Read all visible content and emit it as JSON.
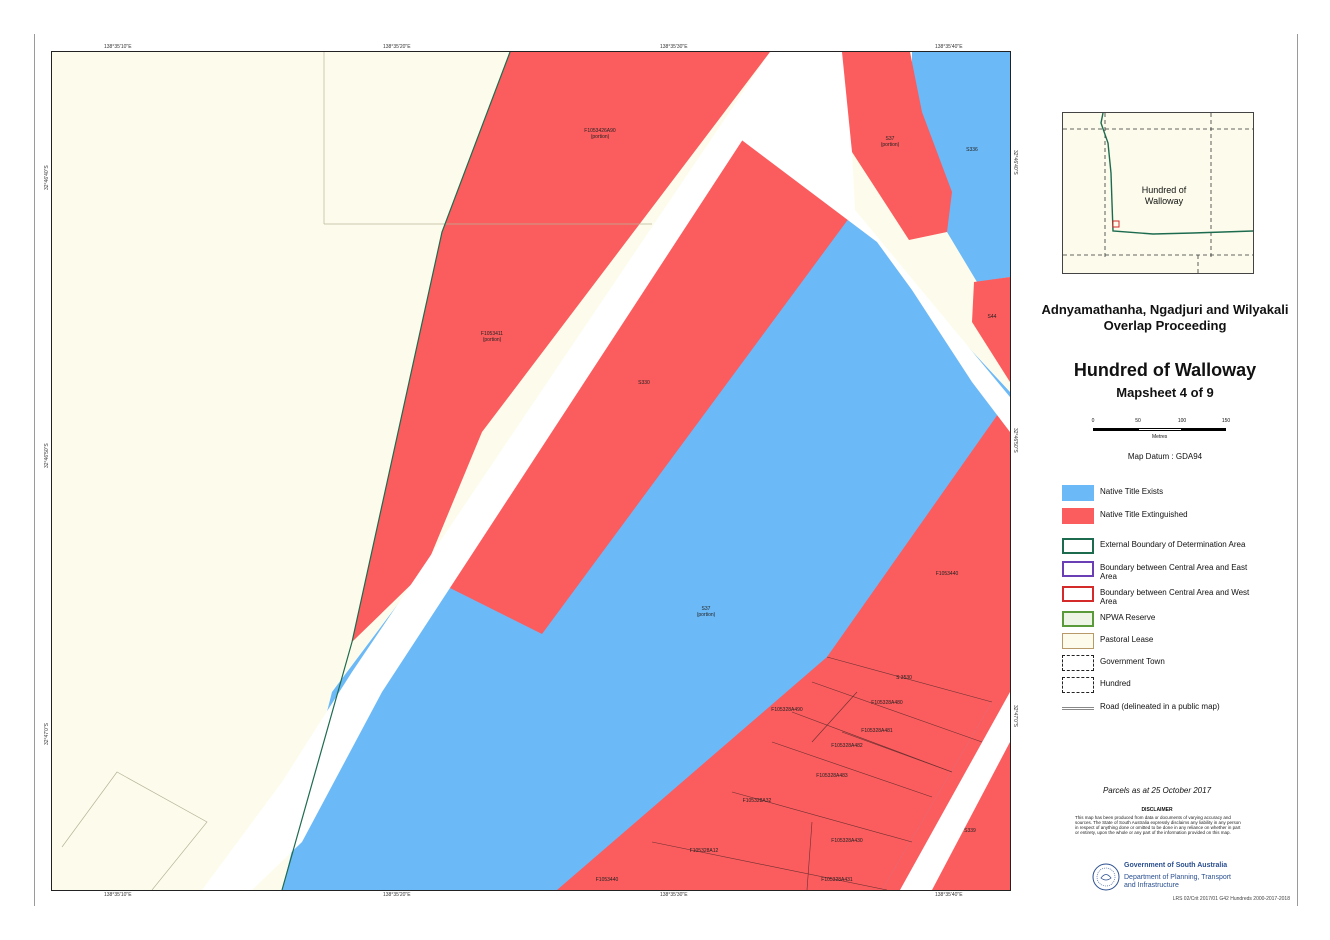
{
  "map": {
    "title": "Hundred of Walloway",
    "proceeding_title": "Adnyamathanha, Ngadjuri and Wilyakali Overlap Proceeding",
    "mapsheet": "Mapsheet 4 of 9",
    "datum": "Map Datum : GDA94",
    "colors": {
      "native_title_exists": "#6cb9f7",
      "native_title_extinguished": "#fb5c5e",
      "pastoral_background": "#fdfcec",
      "road": "#ffffff",
      "boundary_external": "#1d6b4f"
    },
    "parcel_labels": [
      {
        "id": "p1",
        "text": "F1053426A90\n(portion)"
      },
      {
        "id": "p2",
        "text": "F1053411\n(portion)"
      },
      {
        "id": "p3",
        "text": "S330"
      },
      {
        "id": "p4",
        "text": "S37\n(portion)"
      },
      {
        "id": "p5",
        "text": "S336"
      },
      {
        "id": "p6",
        "text": "S44"
      },
      {
        "id": "p7",
        "text": "S38"
      },
      {
        "id": "p8",
        "text": "S37\n(portion)"
      },
      {
        "id": "p9",
        "text": "F1053440"
      },
      {
        "id": "p10",
        "text": "S 3530"
      },
      {
        "id": "p11",
        "text": "F105328A490"
      },
      {
        "id": "p12",
        "text": "F105328A480"
      },
      {
        "id": "p13",
        "text": "F105328A481"
      },
      {
        "id": "p14",
        "text": "F105328A482"
      },
      {
        "id": "p15",
        "text": "F105328A483"
      },
      {
        "id": "p16",
        "text": "F105328A32"
      },
      {
        "id": "p17",
        "text": "F105328A430"
      },
      {
        "id": "p18",
        "text": "F105328A12"
      },
      {
        "id": "p19",
        "text": "F105328A431"
      },
      {
        "id": "p20",
        "text": "F1053440"
      },
      {
        "id": "p21",
        "text": "S339"
      }
    ],
    "ticks_top": [
      "138°35'10\"E",
      "138°35'20\"E",
      "138°35'30\"E",
      "138°35'40\"E"
    ],
    "ticks_bottom": [
      "138°35'10\"E",
      "138°35'20\"E",
      "138°35'30\"E",
      "138°35'40\"E"
    ],
    "ticks_left": [
      "32°46'40\"S",
      "32°46'50\"S",
      "32°47'0\"S"
    ],
    "ticks_right": [
      "32°46'40\"S",
      "32°46'50\"S",
      "32°47'0\"S"
    ]
  },
  "inset": {
    "label": "Hundred of\nWalloway"
  },
  "scalebar": {
    "ticks": [
      "0",
      "50",
      "100",
      "150"
    ],
    "unit": "Metres"
  },
  "legend": {
    "items": [
      {
        "key": "native-title-exists",
        "label": "Native Title Exists",
        "fill": "#6cb9f7",
        "border": "#6cb9f7"
      },
      {
        "key": "native-title-extinguished",
        "label": "Native Title Extinguished",
        "fill": "#fb5c5e",
        "border": "#fb5c5e"
      },
      {
        "key": "external-boundary",
        "label": "External Boundary of Determination Area",
        "fill": "#ffffff",
        "border": "#1d6b4f"
      },
      {
        "key": "central-east-boundary",
        "label": "Boundary between Central Area and East Area",
        "fill": "#ffffff",
        "border": "#6a3fb5"
      },
      {
        "key": "central-west-boundary",
        "label": "Boundary between Central Area and West Area",
        "fill": "#ffffff",
        "border": "#d42a2a"
      },
      {
        "key": "npwa-reserve",
        "label": "NPWA Reserve",
        "fill": "#eef5e6",
        "border": "#5a9a3a"
      },
      {
        "key": "pastoral-lease",
        "label": "Pastoral Lease",
        "fill": "#fdfcec",
        "border": "#b89a6a"
      },
      {
        "key": "government-town",
        "label": "Government Town",
        "fill": "#ffffff",
        "border": "#222222"
      },
      {
        "key": "hundred",
        "label": "Hundred",
        "fill": "#ffffff",
        "border": "#222222"
      },
      {
        "key": "road",
        "label": "Road (delineated in a public map)",
        "fill": "#ffffff",
        "border": "#888888"
      }
    ]
  },
  "footer": {
    "parcels_date": "Parcels as at 25 October 2017",
    "disclaimer_title": "DISCLAIMER",
    "disclaimer_text": "This map has been produced from data or documents of varying accuracy and sources. The State of South Australia expressly disclaims any liability in any person in respect of anything done or omitted to be done in any reliance on whether in part or entirety, upon the whole or any part of the information provided on this map.",
    "gov_name": "Government of South Australia",
    "gov_dept": "Department of Planning, Transport and Infrastructure",
    "map_ref": "LRS 02/Crit 2017/01 G42 Hundreds 2000-2017-2018"
  }
}
